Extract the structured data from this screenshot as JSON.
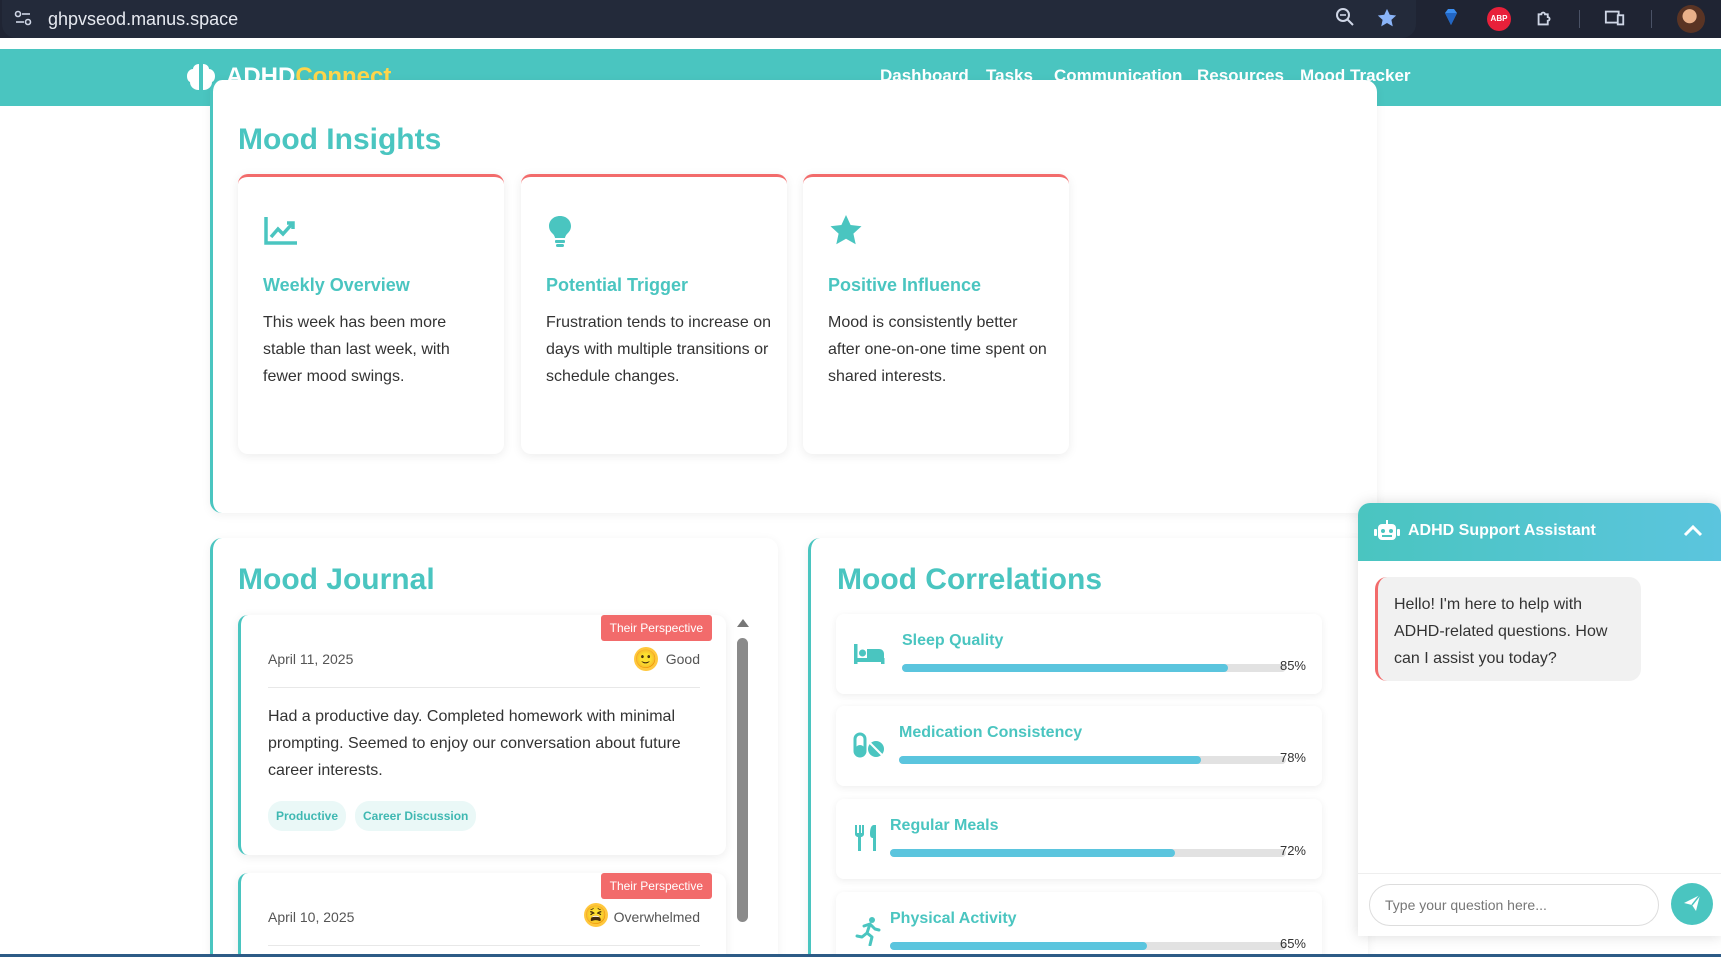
{
  "browser": {
    "url": "ghpvseod.manus.space"
  },
  "nav": {
    "logo_main": "ADHD",
    "logo_accent": "Connect",
    "links": [
      "Dashboard",
      "Tasks",
      "Communication",
      "Resources",
      "Mood Tracker"
    ]
  },
  "insights": {
    "title": "Mood Insights",
    "cards": [
      {
        "icon": "chart-line-icon",
        "title": "Weekly Overview",
        "text": "This week has been more stable than last week, with fewer mood swings."
      },
      {
        "icon": "lightbulb-icon",
        "title": "Potential Trigger",
        "text": "Frustration tends to increase on days with multiple transitions or schedule changes."
      },
      {
        "icon": "star-icon",
        "title": "Positive Influence",
        "text": "Mood is consistently better after one-on-one time spent on shared interests."
      }
    ]
  },
  "journal": {
    "title": "Mood Journal",
    "entries": [
      {
        "badge": "Their Perspective",
        "date": "April 11, 2025",
        "mood": "Good",
        "emoji": "🙂",
        "text": "Had a productive day. Completed homework with minimal prompting. Seemed to enjoy our conversation about future career interests.",
        "tags": [
          "Productive",
          "Career Discussion"
        ]
      },
      {
        "badge": "Their Perspective",
        "date": "April 10, 2025",
        "mood": "Overwhelmed",
        "emoji": "😫"
      }
    ]
  },
  "correlations": {
    "title": "Mood Correlations",
    "items": [
      {
        "icon": "bed-icon",
        "label": "Sleep Quality",
        "percent": 85,
        "percent_label": "85%"
      },
      {
        "icon": "pills-icon",
        "label": "Medication Consistency",
        "percent": 78,
        "percent_label": "78%"
      },
      {
        "icon": "utensils-icon",
        "label": "Regular Meals",
        "percent": 72,
        "percent_label": "72%"
      },
      {
        "icon": "running-icon",
        "label": "Physical Activity",
        "percent": 65,
        "percent_label": "65%"
      }
    ]
  },
  "chat": {
    "title": "ADHD Support Assistant",
    "message": "Hello! I'm here to help with ADHD-related questions. How can I assist you today?",
    "input_placeholder": "Type your question here..."
  },
  "colors": {
    "primary": "#4ac5c0",
    "accent_yellow": "#ffd54a",
    "badge_red": "#f26b6b",
    "progress": "#5bc5de"
  }
}
